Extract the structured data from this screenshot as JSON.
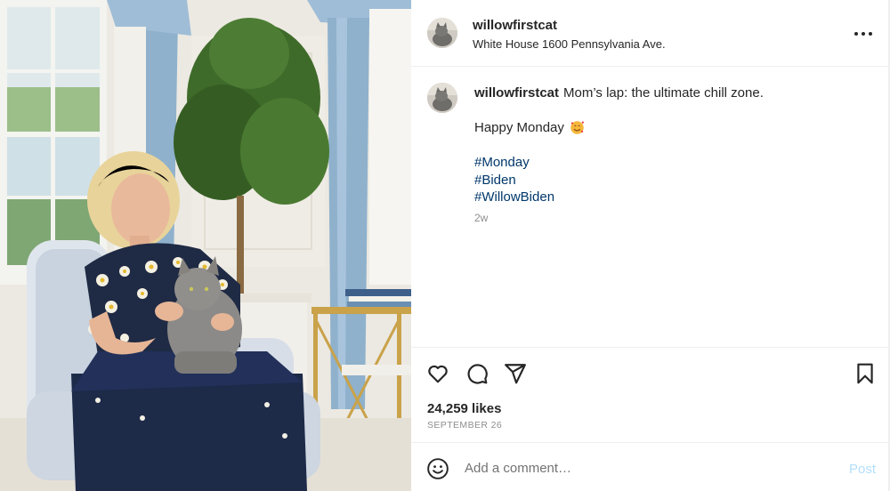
{
  "post": {
    "username": "willowfirstcat",
    "location": "White House 1600 Pennsylvania Ave.",
    "more_icon": "more-horizontal-icon",
    "caption": {
      "username": "willowfirstcat",
      "text": "Mom’s lap: the ultimate chill zone.",
      "line2": "Happy Monday",
      "emoji_icon": "smiling-face-with-hearts-icon",
      "hashtags": [
        "#Monday",
        "#Biden",
        "#WillowBiden"
      ],
      "age": "2w"
    },
    "actions": {
      "like_icon": "heart-icon",
      "comment_icon": "comment-bubble-icon",
      "share_icon": "paper-plane-icon",
      "save_icon": "bookmark-icon"
    },
    "likes": "24,259 likes",
    "date": "SEPTEMBER 26",
    "comment_box": {
      "emoji_icon": "smile-icon",
      "placeholder": "Add a comment…",
      "post_label": "Post"
    }
  },
  "colors": {
    "text": "#262626",
    "secondary": "#8e8e8e",
    "hashtag": "#00376b",
    "post_disabled": "#b2dffc",
    "divider": "#efefef"
  }
}
